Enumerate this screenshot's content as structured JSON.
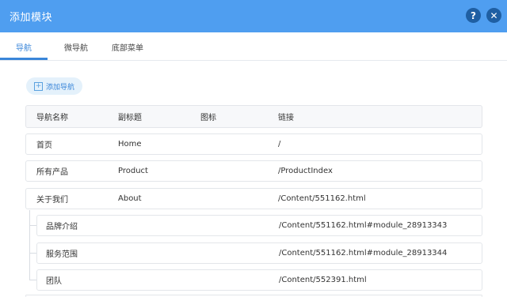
{
  "dialog": {
    "title": "添加模块",
    "help_glyph": "?",
    "close_glyph": "✕"
  },
  "tabs": [
    {
      "label": "导航",
      "active": true
    },
    {
      "label": "微导航",
      "active": false
    },
    {
      "label": "底部菜单",
      "active": false
    }
  ],
  "add_button": {
    "label": "添加导航",
    "icon": "plus-square-icon"
  },
  "table": {
    "columns": [
      "导航名称",
      "副标题",
      "图标",
      "链接"
    ],
    "rows": [
      {
        "name": "首页",
        "subtitle": "Home",
        "icon": "",
        "link": "/",
        "child": false
      },
      {
        "name": "所有产品",
        "subtitle": "Product",
        "icon": "",
        "link": "/ProductIndex",
        "child": false
      },
      {
        "name": "关于我们",
        "subtitle": "About",
        "icon": "",
        "link": "/Content/551162.html",
        "child": false
      },
      {
        "name": "品牌介绍",
        "subtitle": "",
        "icon": "",
        "link": "/Content/551162.html#module_28913343",
        "child": true
      },
      {
        "name": "服务范围",
        "subtitle": "",
        "icon": "",
        "link": "/Content/551162.html#module_28913344",
        "child": true
      },
      {
        "name": "团队",
        "subtitle": "",
        "icon": "",
        "link": "/Content/552391.html",
        "child": true
      }
    ]
  },
  "colors": {
    "titlebar": "#4f9ef0",
    "accent": "#3a86d9",
    "button_dark": "#1f5fa3",
    "add_bg": "#e4f1fb"
  }
}
